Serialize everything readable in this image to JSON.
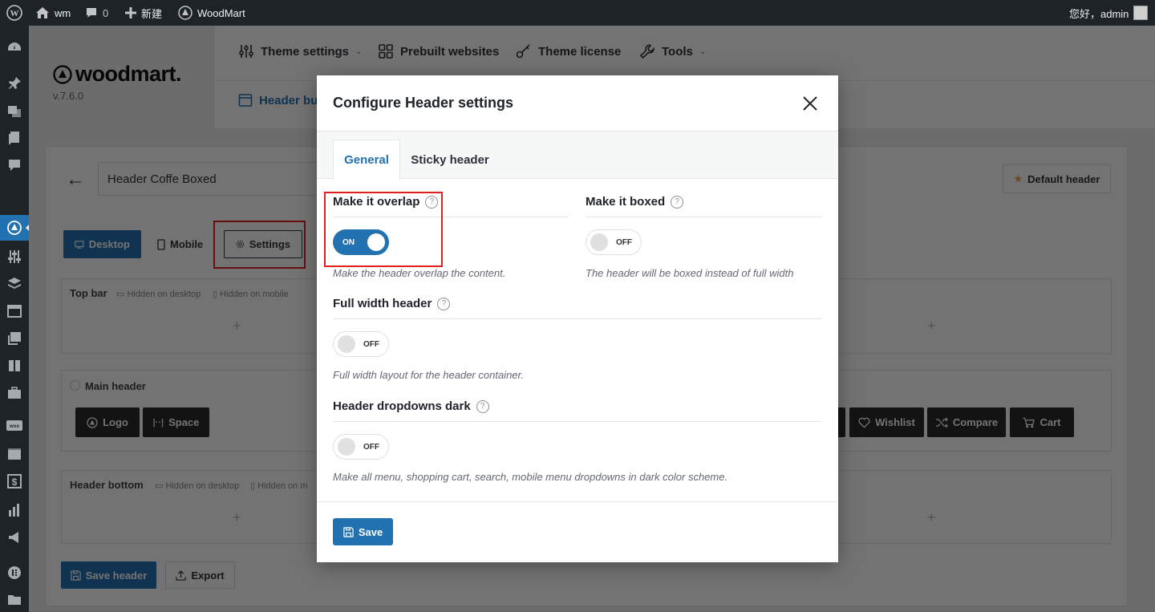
{
  "adminbar": {
    "site_name": "wm",
    "comments_count": "0",
    "new_label": "新建",
    "plugin_label": "WoodMart",
    "greeting": "您好，admin"
  },
  "brand": {
    "logo_text": "woodmart.",
    "version": "v.7.6.0"
  },
  "topnav": {
    "items": [
      {
        "label": "Theme settings",
        "icon": "sliders-icon",
        "dropdown": true
      },
      {
        "label": "Prebuilt websites",
        "icon": "grid-icon",
        "dropdown": false
      },
      {
        "label": "Theme license",
        "icon": "key-icon",
        "dropdown": false
      },
      {
        "label": "Tools",
        "icon": "wrench-icon",
        "dropdown": true
      }
    ],
    "sub_label": "Header bu"
  },
  "builder": {
    "header_name": "Header Coffe Boxed",
    "default_header_label": "Default header",
    "view_tabs": [
      "Desktop",
      "Mobile",
      "Settings"
    ],
    "rows": {
      "top_bar": {
        "title": "Top bar",
        "hint_desktop": "Hidden on desktop",
        "hint_mobile": "Hidden on mobile"
      },
      "main_header": {
        "title": "Main header"
      },
      "header_bottom": {
        "title": "Header bottom",
        "hint_desktop": "Hidden on desktop",
        "hint_mobile": "Hidden on m"
      }
    },
    "elements_left": [
      "Logo",
      "Space"
    ],
    "elements_right": [
      "Wishlist",
      "Compare",
      "Cart"
    ],
    "save_header_label": "Save header",
    "export_label": "Export"
  },
  "modal": {
    "title": "Configure Header settings",
    "tabs": [
      "General",
      "Sticky header"
    ],
    "options": {
      "overlap": {
        "label": "Make it overlap",
        "state": "ON",
        "desc": "Make the header overlap the content."
      },
      "boxed": {
        "label": "Make it boxed",
        "state": "OFF",
        "desc": "The header will be boxed instead of full width"
      },
      "full_width": {
        "label": "Full width header",
        "state": "OFF",
        "desc": "Full width layout for the header container."
      },
      "dropdowns_dark": {
        "label": "Header dropdowns dark",
        "state": "OFF",
        "desc": "Make all menu, shopping cart, search, mobile menu dropdowns in dark color scheme."
      }
    },
    "qmark": "?",
    "save_label": "Save"
  },
  "colors": {
    "accent": "#2271b1",
    "admin_bar": "#1d2327",
    "highlight": "#e32020"
  }
}
